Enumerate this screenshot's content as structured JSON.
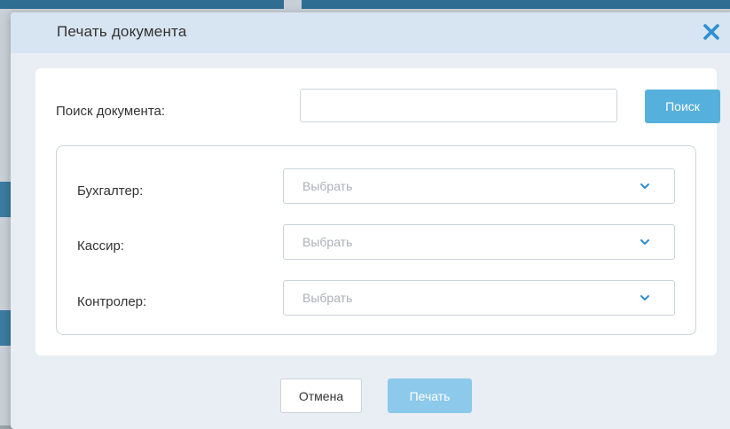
{
  "dialog": {
    "title": "Печать документа",
    "close_icon": "close-icon"
  },
  "search": {
    "label": "Поиск документа:",
    "value": "",
    "placeholder": "",
    "button_label": "Поиск"
  },
  "fields": [
    {
      "label": "Бухгалтер:",
      "placeholder": "Выбрать"
    },
    {
      "label": "Кассир:",
      "placeholder": "Выбрать"
    },
    {
      "label": "Контролер:",
      "placeholder": "Выбрать"
    }
  ],
  "footer": {
    "cancel_label": "Отмена",
    "print_label": "Печать"
  },
  "colors": {
    "accent": "#55b0dc",
    "accent_disabled": "#8cc9ea",
    "header_bg": "#d7e4f1",
    "close_icon": "#2e8fd1"
  }
}
